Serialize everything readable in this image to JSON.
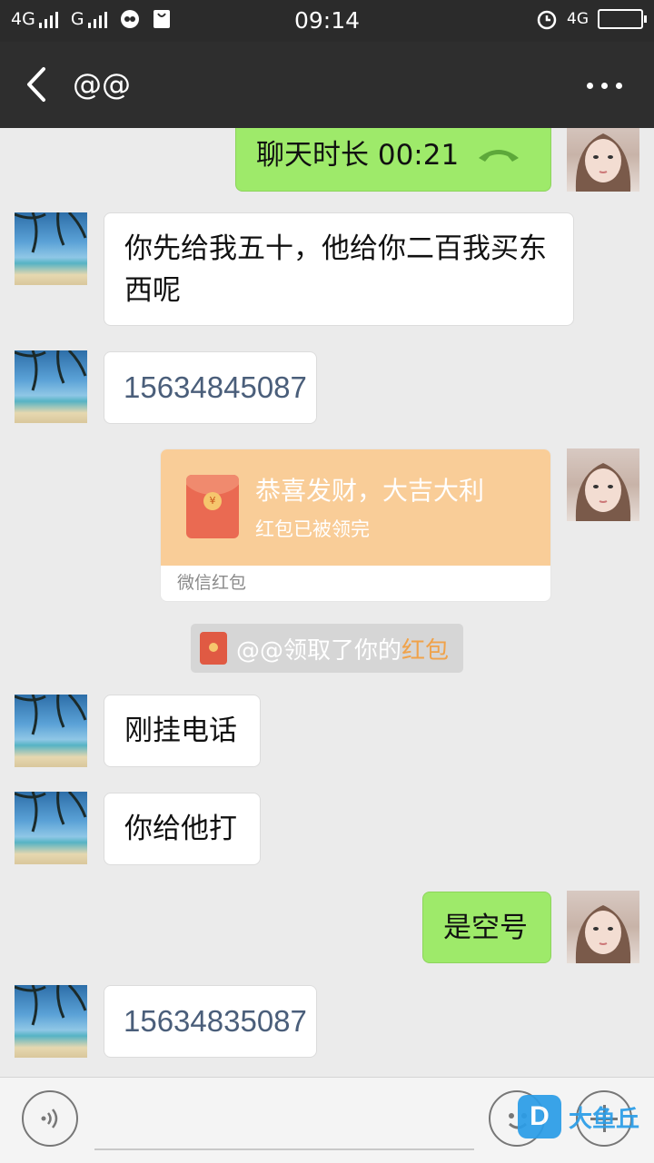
{
  "status_bar": {
    "network1": "4G",
    "network2": "G",
    "time": "09:14",
    "network3": "4G"
  },
  "header": {
    "back_icon": "chevron-left-icon",
    "title": "@@",
    "more_icon": "more-dots-icon"
  },
  "messages": [
    {
      "side": "right",
      "type": "call",
      "text": "聊天时长 00:21",
      "icon": "phone-icon"
    },
    {
      "side": "left",
      "type": "text",
      "text": "你先给我五十，他给你二百我买东西呢"
    },
    {
      "side": "left",
      "type": "number",
      "text": "15634845087"
    },
    {
      "side": "right",
      "type": "red_packet",
      "title": "恭喜发财，大吉大利",
      "status": "红包已被领完",
      "footer": "微信红包",
      "coin": "¥"
    },
    {
      "side": "center",
      "type": "system",
      "text": "@@领取了你的",
      "highlight": "红包"
    },
    {
      "side": "left",
      "type": "text",
      "text": "刚挂电话"
    },
    {
      "side": "left",
      "type": "text",
      "text": "你给他打"
    },
    {
      "side": "right",
      "type": "text",
      "text": "是空号"
    },
    {
      "side": "left",
      "type": "number",
      "text": "15634835087"
    }
  ],
  "input_bar": {
    "voice_icon": "voice-icon",
    "emoji_icon": "emoji-icon",
    "plus_icon": "plus-icon",
    "input_value": ""
  },
  "watermark": {
    "logo": "D",
    "text": "大鱼丘"
  },
  "colors": {
    "title_bar": "#2e2e2e",
    "chat_bg": "#ebebeb",
    "bubble_green": "#9eea6a",
    "red_packet": "#f9cd98"
  }
}
